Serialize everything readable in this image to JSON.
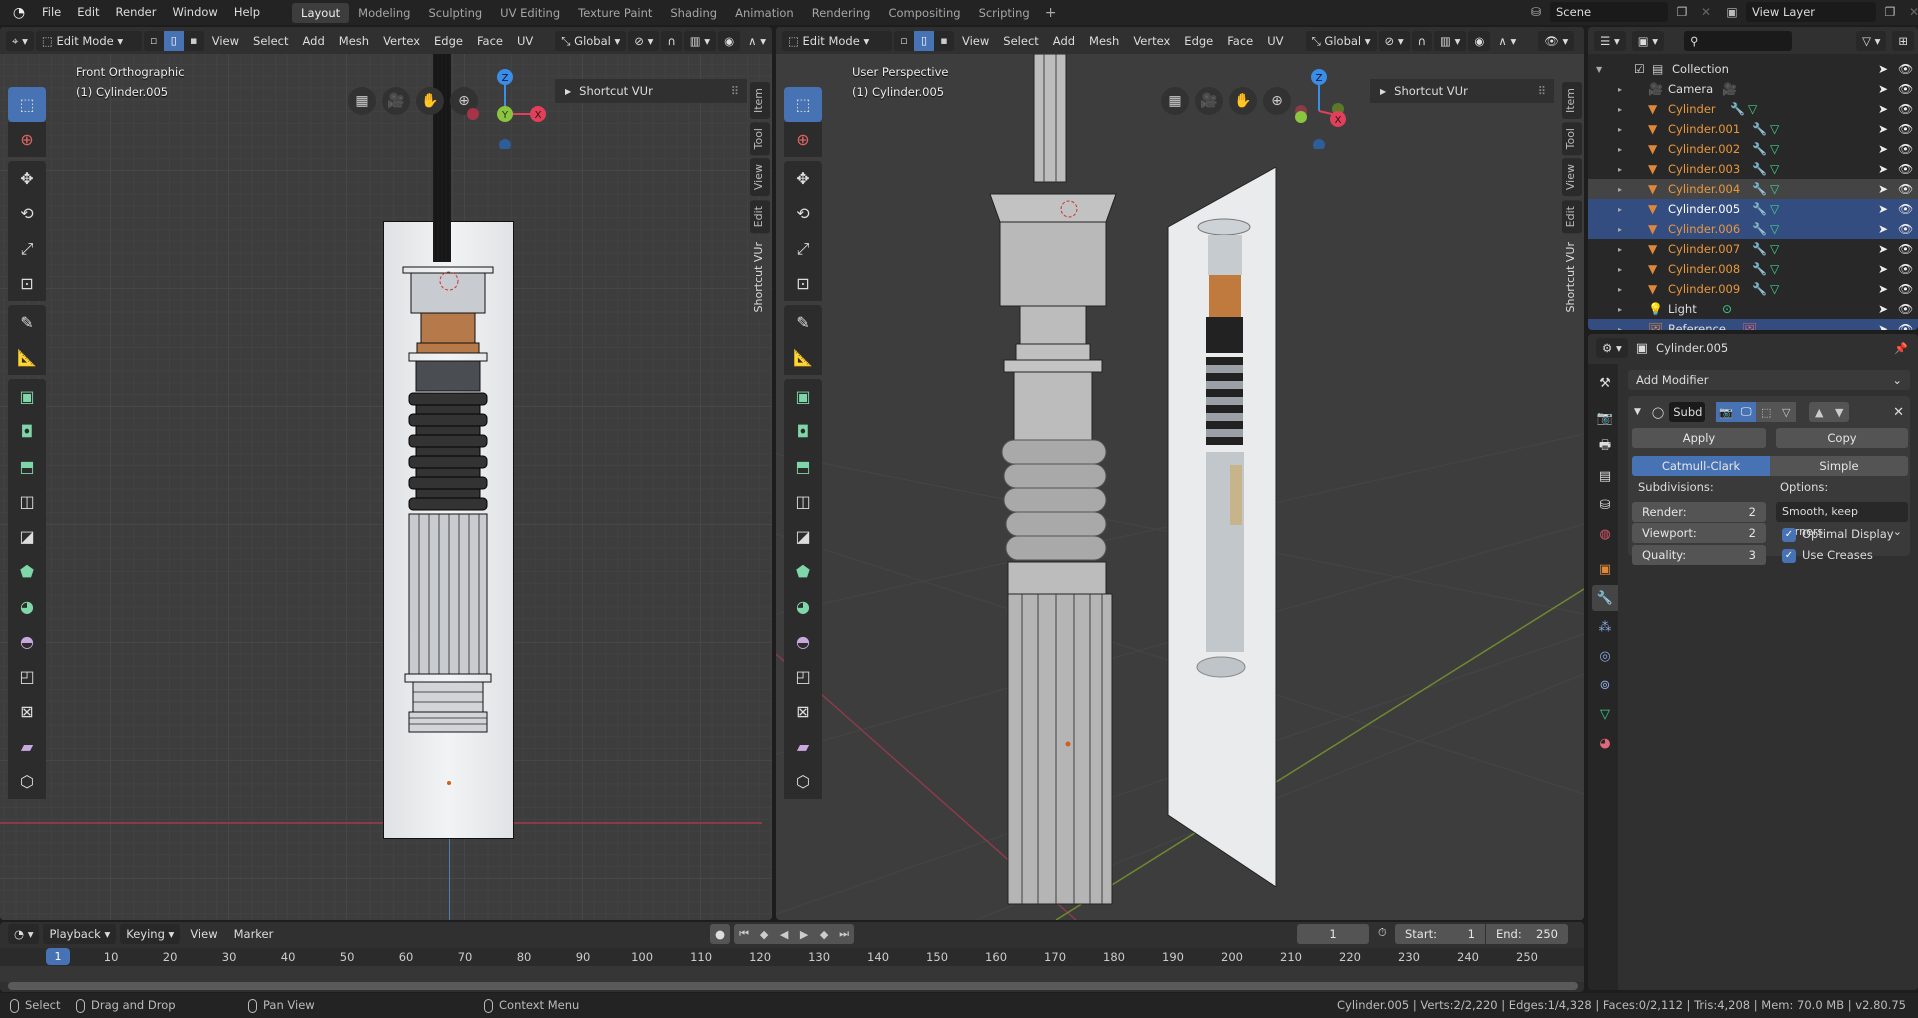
{
  "topbar": {
    "menu": [
      "File",
      "Edit",
      "Render",
      "Window",
      "Help"
    ],
    "workspaces": [
      "Layout",
      "Modeling",
      "Sculpting",
      "UV Editing",
      "Texture Paint",
      "Shading",
      "Animation",
      "Rendering",
      "Compositing",
      "Scripting"
    ],
    "active_workspace": "Layout",
    "add_workspace": "+",
    "scene": "Scene",
    "view_layer": "View Layer"
  },
  "viewport_left": {
    "mode": "Edit Mode",
    "menus": [
      "View",
      "Select",
      "Add",
      "Mesh",
      "Vertex",
      "Edge",
      "Face",
      "UV"
    ],
    "transform_orientation": "Global",
    "view_name": "Front Orthographic",
    "object_label": "(1) Cylinder.005",
    "npanel_title": "Shortcut VUr",
    "ntabs": [
      "Item",
      "Tool",
      "View",
      "Edit",
      "Shortcut VUr"
    ],
    "active_ntab": "Shortcut VUr",
    "gizmo": {
      "z": "Z",
      "y": "Y",
      "x": "X"
    }
  },
  "viewport_right": {
    "mode": "Edit Mode",
    "menus": [
      "View",
      "Select",
      "Add",
      "Mesh",
      "Vertex",
      "Edge",
      "Face",
      "UV"
    ],
    "transform_orientation": "Global",
    "view_name": "User Perspective",
    "object_label": "(1) Cylinder.005",
    "npanel_title": "Shortcut VUr",
    "ntabs": [
      "Item",
      "Tool",
      "View",
      "Edit",
      "Shortcut VUr"
    ],
    "active_ntab": "Shortcut VUr",
    "gizmo": {
      "z": "Z",
      "x": "X"
    }
  },
  "tools": [
    "select-box",
    "cursor",
    "move",
    "rotate",
    "scale",
    "transform",
    "annotate",
    "measure",
    "extrude-region",
    "inset-faces",
    "bevel",
    "loop-cut",
    "knife",
    "poly-build",
    "spin",
    "smooth",
    "edge-slide",
    "shrink-fatten",
    "shear",
    "rip-region"
  ],
  "outliner": {
    "search_placeholder": "",
    "items": [
      {
        "name": "Collection",
        "type": "collection",
        "indent": 0,
        "selected": false
      },
      {
        "name": "Camera",
        "type": "camera",
        "indent": 1,
        "data_icon": "camera-data",
        "selected": false
      },
      {
        "name": "Cylinder",
        "type": "mesh",
        "indent": 1,
        "modifier": true,
        "selected": false
      },
      {
        "name": "Cylinder.001",
        "type": "mesh",
        "indent": 1,
        "modifier": true,
        "selected": false
      },
      {
        "name": "Cylinder.002",
        "type": "mesh",
        "indent": 1,
        "modifier": true,
        "selected": false
      },
      {
        "name": "Cylinder.003",
        "type": "mesh",
        "indent": 1,
        "modifier": true,
        "selected": false
      },
      {
        "name": "Cylinder.004",
        "type": "mesh",
        "indent": 1,
        "modifier": true,
        "highlight": true,
        "selected": false
      },
      {
        "name": "Cylinder.005",
        "type": "mesh",
        "indent": 1,
        "modifier": true,
        "selected": true,
        "active": true
      },
      {
        "name": "Cylinder.006",
        "type": "mesh",
        "indent": 1,
        "modifier": true,
        "selected": true
      },
      {
        "name": "Cylinder.007",
        "type": "mesh",
        "indent": 1,
        "modifier": true,
        "selected": false
      },
      {
        "name": "Cylinder.008",
        "type": "mesh",
        "indent": 1,
        "modifier": true,
        "selected": false
      },
      {
        "name": "Cylinder.009",
        "type": "mesh",
        "indent": 1,
        "modifier": true,
        "selected": false
      },
      {
        "name": "Light",
        "type": "light",
        "indent": 1,
        "data_icon": "light-data",
        "selected": false
      },
      {
        "name": "Reference",
        "type": "image",
        "indent": 1,
        "data_icon": "image-data",
        "selected": true
      }
    ]
  },
  "properties": {
    "object_name": "Cylinder.005",
    "add_modifier": "Add Modifier",
    "modifier": {
      "name": "Subd",
      "apply": "Apply",
      "copy": "Copy",
      "types": [
        "Catmull-Clark",
        "Simple"
      ],
      "active_type": "Catmull-Clark",
      "subdivisions_label": "Subdivisions:",
      "render_label": "Render:",
      "render_value": "2",
      "viewport_label": "Viewport:",
      "viewport_value": "2",
      "quality_label": "Quality:",
      "quality_value": "3",
      "options_label": "Options:",
      "uv_smooth": "Smooth, keep corners",
      "optimal_display_label": "Optimal Display",
      "optimal_display": true,
      "use_creases_label": "Use Creases",
      "use_creases": true
    },
    "tabs": [
      "tool",
      "render",
      "output",
      "view-layer",
      "scene",
      "world",
      "object",
      "modifiers",
      "particles",
      "physics",
      "constraints",
      "data",
      "material"
    ],
    "active_tab": "modifiers"
  },
  "timeline": {
    "menus": [
      "Playback",
      "Keying",
      "View",
      "Marker"
    ],
    "current_frame": "1",
    "start_label": "Start:",
    "start": "1",
    "end_label": "End:",
    "end": "250",
    "ticks": [
      "10",
      "20",
      "30",
      "40",
      "50",
      "60",
      "70",
      "80",
      "90",
      "100",
      "110",
      "120",
      "130",
      "140",
      "150",
      "160",
      "170",
      "180",
      "190",
      "200",
      "210",
      "220",
      "230",
      "240",
      "250"
    ],
    "playhead_label": "1"
  },
  "statusbar": {
    "select": "Select",
    "drag": "Drag and Drop",
    "pan": "Pan View",
    "context": "Context Menu",
    "stats": "Cylinder.005 | Verts:2/2,220 | Edges:1/4,328 | Faces:0/2,112 | Tris:4,208 | Mem: 70.0 MB | v2.80.75"
  },
  "colors": {
    "accent": "#4772b3",
    "object_orange": "#e8973c",
    "selection_row": "#334d80",
    "axis_x": "#e0405a",
    "axis_y": "#8bc53f",
    "axis_z": "#3a8ee6"
  }
}
